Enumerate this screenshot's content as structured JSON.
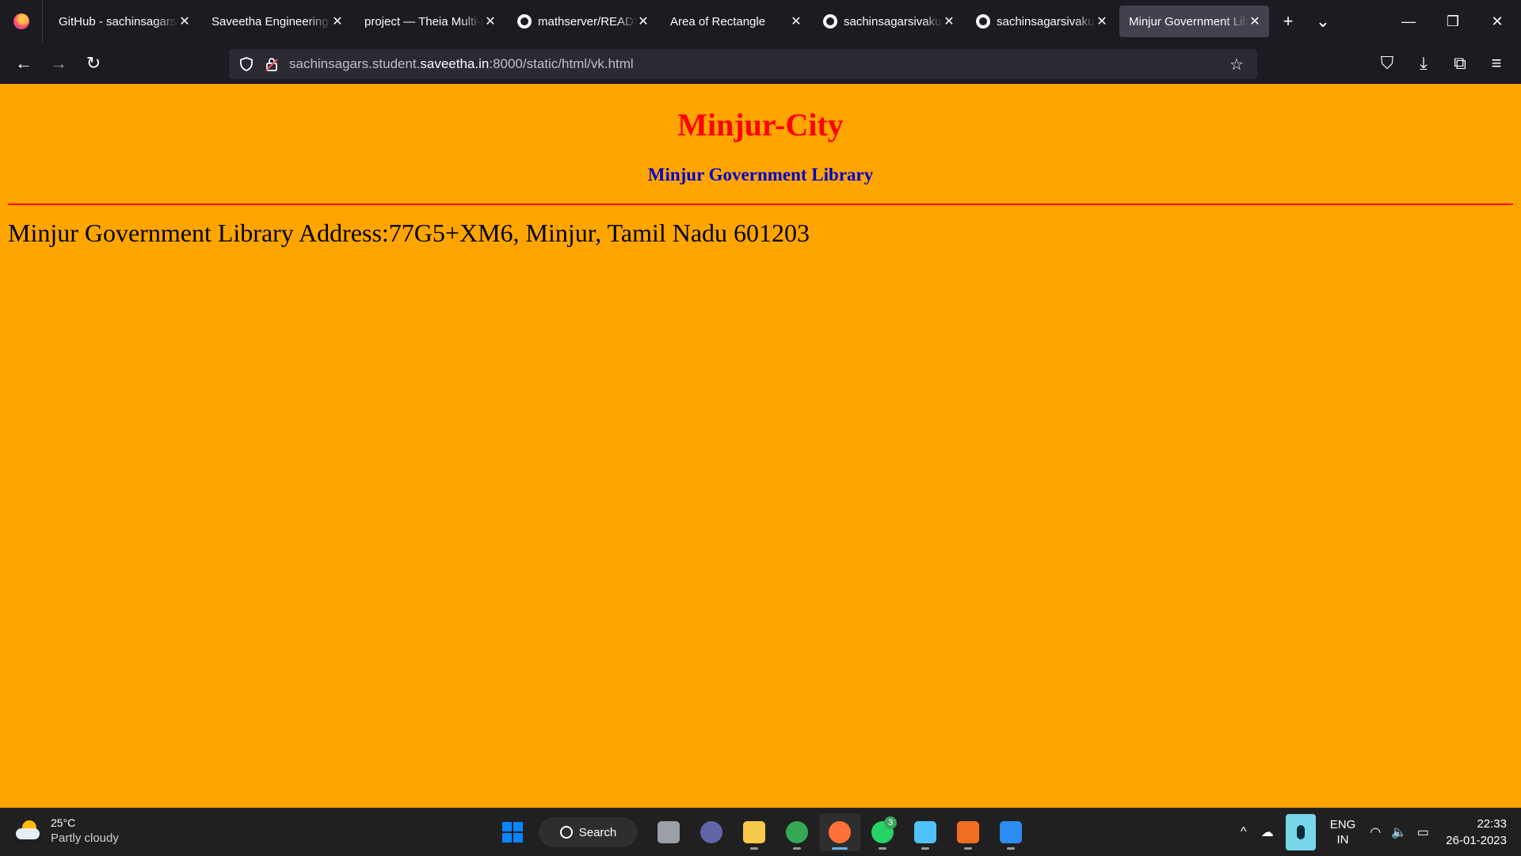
{
  "browser": {
    "tabs": [
      {
        "label": "GitHub - sachinsagarsivakumar",
        "icon": "",
        "active": false
      },
      {
        "label": "Saveetha Engineering College",
        "icon": "",
        "active": false
      },
      {
        "label": "project — Theia Multi-Language",
        "icon": "",
        "active": false
      },
      {
        "label": "mathserver/README.md",
        "icon": "github-icon",
        "active": false
      },
      {
        "label": "Area of Rectangle",
        "icon": "",
        "active": false
      },
      {
        "label": "sachinsagarsivakumar",
        "icon": "github-icon",
        "active": false
      },
      {
        "label": "sachinsagarsivakumar",
        "icon": "github-icon",
        "active": false
      },
      {
        "label": "Minjur Government Library",
        "icon": "",
        "active": true
      }
    ],
    "tab_close_glyph": "✕",
    "new_tab_glyph": "+",
    "list_tabs_glyph": "⌄",
    "window": {
      "minimize": "—",
      "restore": "❐",
      "close": "✕"
    },
    "nav": {
      "back": "←",
      "forward": "→",
      "reload": "↻"
    },
    "url": {
      "prefix": "sachinsagars.student.",
      "host": "saveetha.in",
      "suffix": ":8000/static/html/vk.html"
    },
    "bookmark_glyph": "☆",
    "tools": {
      "pocket": "⛉",
      "downloads": "⤓",
      "extensions": "⧉",
      "menu": "≡"
    }
  },
  "page": {
    "title": "Minjur-City",
    "subtitle": "Minjur Government Library",
    "address": "Minjur Government Library Address:77G5+XM6, Minjur, Tamil Nadu 601203",
    "colors": {
      "background": "#ffa500",
      "title": "#ff0000",
      "subtitle": "#0000cd",
      "rule": "#ff0000"
    }
  },
  "taskbar": {
    "weather": {
      "temp": "25°C",
      "condition": "Partly cloudy"
    },
    "search_label": "Search",
    "apps": [
      {
        "name": "start-icon",
        "color": "#0a84ff",
        "active": false,
        "running": false
      },
      {
        "name": "task-view-icon",
        "color": "#9aa0a6",
        "active": false,
        "running": false
      },
      {
        "name": "teams-chat-icon",
        "color": "#6264a7",
        "active": false,
        "running": false
      },
      {
        "name": "file-explorer-icon",
        "color": "#f7c948",
        "active": false,
        "running": true
      },
      {
        "name": "chrome-icon",
        "color": "#34a853",
        "active": false,
        "running": true
      },
      {
        "name": "firefox-icon",
        "color": "#ff7139",
        "active": true,
        "running": true
      },
      {
        "name": "whatsapp-icon",
        "color": "#25d366",
        "active": false,
        "running": true,
        "badge": "3"
      },
      {
        "name": "notepad-icon",
        "color": "#4fc3f7",
        "active": false,
        "running": true
      },
      {
        "name": "fusion360-icon",
        "color": "#f26f21",
        "active": false,
        "running": true
      },
      {
        "name": "photos-icon",
        "color": "#2d8cf0",
        "active": false,
        "running": true
      }
    ],
    "tray": {
      "chevron": "^",
      "cloud": "☁",
      "wifi": "◠",
      "volume": "🔈",
      "battery": "▭"
    },
    "lang": {
      "line1": "ENG",
      "line2": "IN"
    },
    "clock": {
      "time": "22:33",
      "date": "26-01-2023"
    }
  }
}
